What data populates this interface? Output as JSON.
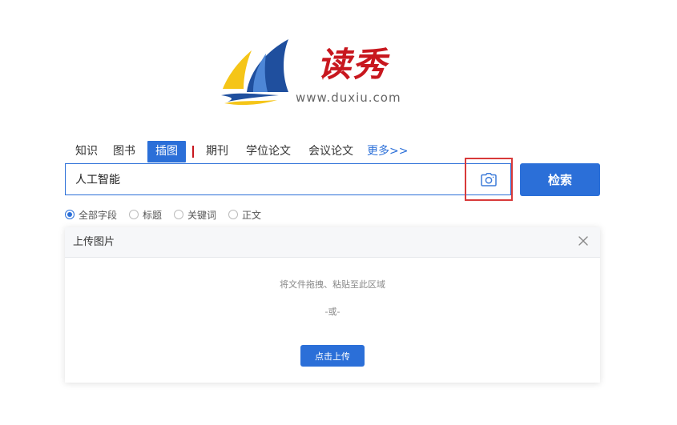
{
  "logo": {
    "cn_name": "读秀",
    "url": "www.duxiu.com"
  },
  "tabs": [
    {
      "label": "知识"
    },
    {
      "label": "图书"
    },
    {
      "label": "插图",
      "active": true
    },
    {
      "label": "期刊"
    },
    {
      "label": "学位论文"
    },
    {
      "label": "会议论文"
    }
  ],
  "tab_more": "更多>>",
  "search": {
    "value": "人工智能",
    "button_label": "检索"
  },
  "radios": [
    {
      "label": "全部字段",
      "checked": true
    },
    {
      "label": "标题",
      "checked": false
    },
    {
      "label": "关键词",
      "checked": false
    },
    {
      "label": "正文",
      "checked": false
    }
  ],
  "upload": {
    "title": "上传图片",
    "hint": "将文件拖拽、粘贴至此区域",
    "or": "-或-",
    "button_label": "点击上传"
  },
  "colors": {
    "accent": "#2b6fd8",
    "brand_red": "#c8171e",
    "highlight_border": "#d83a3a"
  },
  "icons": {
    "camera": "camera-icon",
    "close": "close-icon"
  }
}
